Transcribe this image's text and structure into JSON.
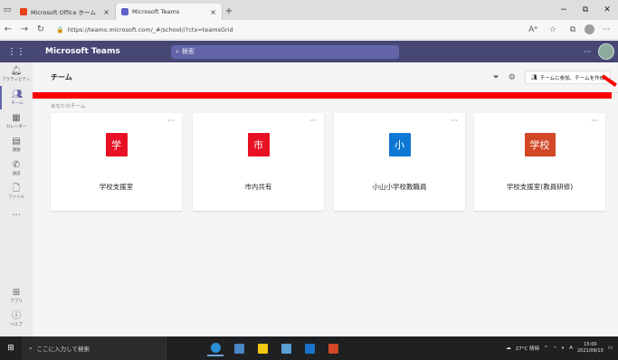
{
  "browser": {
    "tabs": [
      {
        "title": "Microsoft Office ホーム",
        "active": false
      },
      {
        "title": "Microsoft Teams",
        "active": true
      }
    ],
    "new_tab": "+",
    "url": "https://teams.microsoft.com/_#/school//?ctx=teamsGrid",
    "window_controls": [
      "−",
      "⧉",
      "✕"
    ]
  },
  "teams": {
    "app_title": "Microsoft Teams",
    "search_placeholder": "検索",
    "more": "···"
  },
  "rail": {
    "items": [
      {
        "label": "アクティビティ",
        "icon": "bell-icon"
      },
      {
        "label": "チーム",
        "icon": "teams-icon",
        "active": true
      },
      {
        "label": "カレンダー",
        "icon": "calendar-icon"
      },
      {
        "label": "課題",
        "icon": "assignments-icon"
      },
      {
        "label": "通話",
        "icon": "phone-icon"
      },
      {
        "label": "ファイル",
        "icon": "files-icon"
      },
      {
        "label": "···",
        "icon": "more-icon"
      }
    ],
    "bottom": [
      {
        "label": "アプリ",
        "icon": "apps-icon"
      },
      {
        "label": "ヘルプ",
        "icon": "help-icon"
      }
    ]
  },
  "main": {
    "title": "チーム",
    "create_button": "チームに参加、チームを作成",
    "section_label": "あなたのチーム",
    "teams": [
      {
        "name": "学校支援室",
        "logo": "学",
        "color": "#e81123"
      },
      {
        "name": "市内共有",
        "logo": "市",
        "color": "#e81123"
      },
      {
        "name": "小山小学校教職員",
        "logo": "小",
        "color": "#0f78d4"
      },
      {
        "name": "学校支援室(教員研修)",
        "logo": "学校",
        "color": "#d24726"
      }
    ]
  },
  "taskbar": {
    "search_placeholder": "ここに入力して検索",
    "weather": "27°C 晴時",
    "ime": "A",
    "time": "15:00",
    "date": "2021/09/10"
  }
}
